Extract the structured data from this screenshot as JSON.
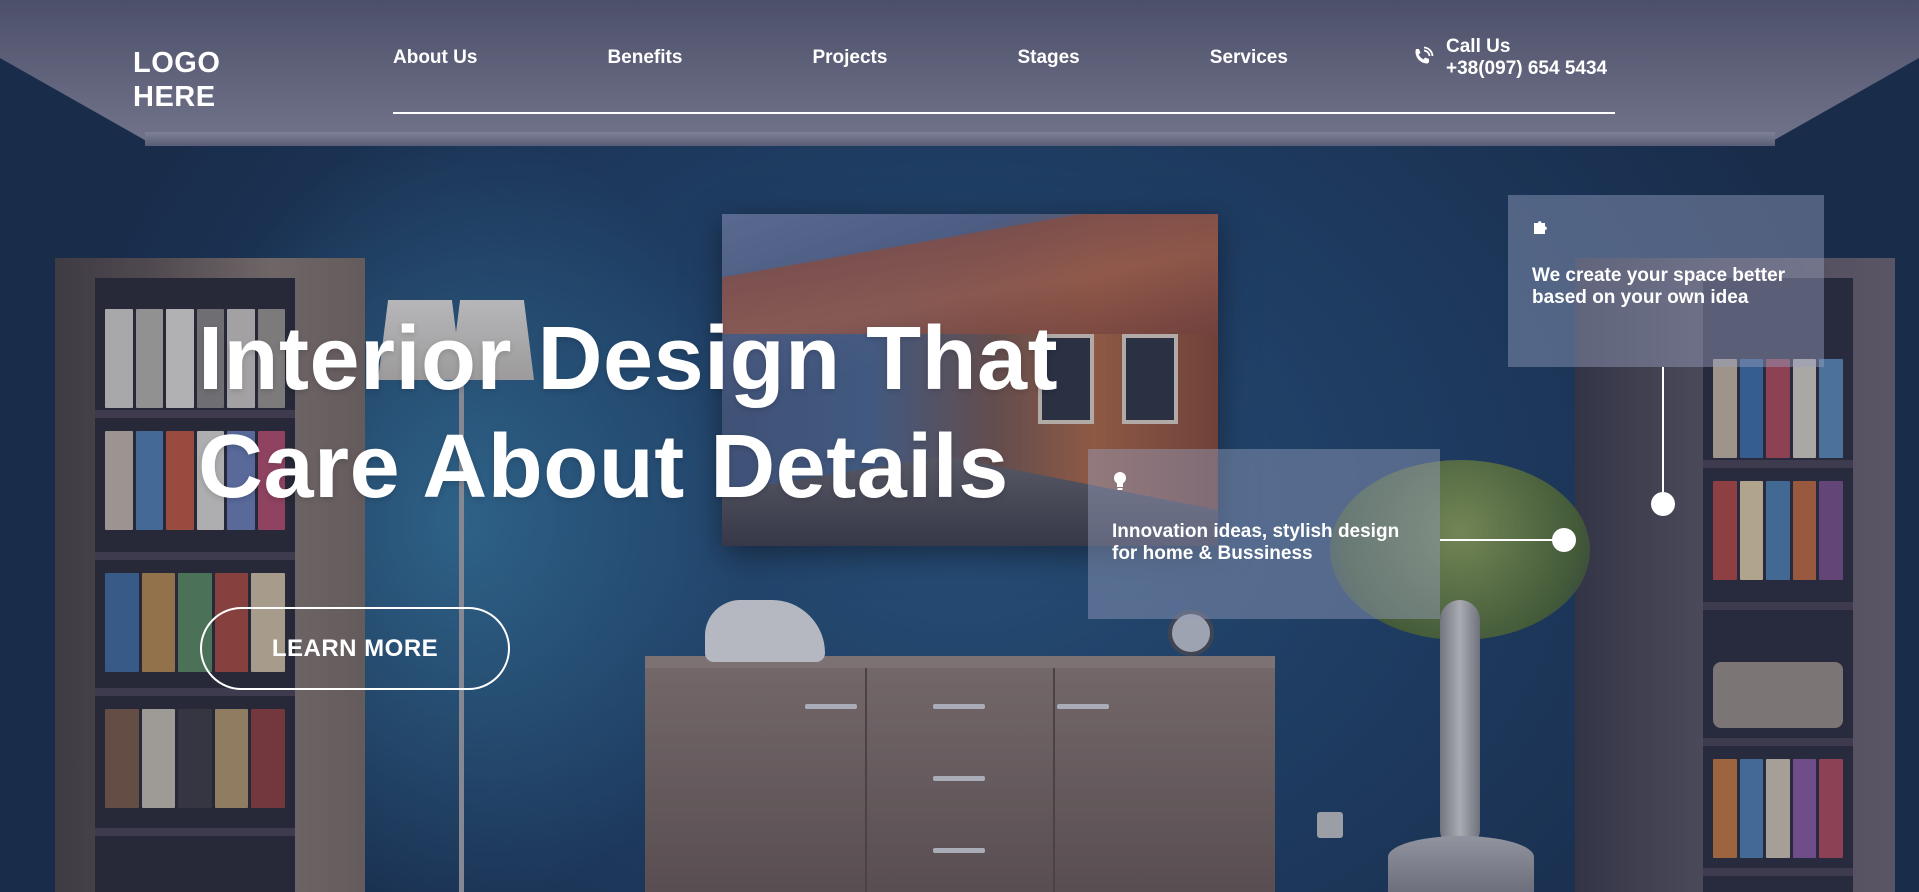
{
  "header": {
    "logo_line1": "LOGO",
    "logo_line2": "HERE",
    "nav": [
      {
        "label": "About Us"
      },
      {
        "label": "Benefits"
      },
      {
        "label": "Projects"
      },
      {
        "label": "Stages"
      },
      {
        "label": "Services"
      }
    ],
    "call": {
      "label": "Call Us",
      "phone": "+38(097) 654 5434",
      "icon": "phone-icon"
    }
  },
  "hero": {
    "headline_line1": "Interior Design That",
    "headline_line2": "Care About Details",
    "cta_label": "LEARN MORE"
  },
  "cards": [
    {
      "icon": "puzzle-icon",
      "text": "We create your space better based on your own idea"
    },
    {
      "icon": "lightbulb-icon",
      "text": "Innovation ideas, stylish design for home & Bussiness"
    }
  ],
  "colors": {
    "text": "#ffffff",
    "card_bg": "rgba(150,160,190,0.45)",
    "wall": "#1f456d"
  }
}
